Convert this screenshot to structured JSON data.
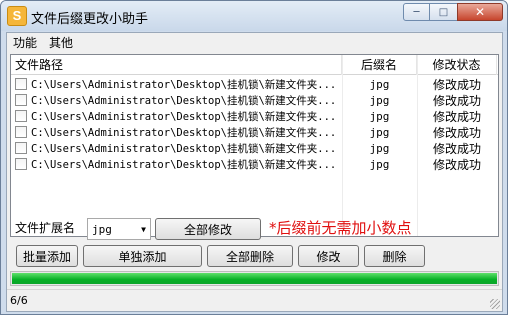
{
  "window": {
    "title": "文件后缀更改小助手",
    "icon_letter": "S",
    "buttons": {
      "minimize": "─",
      "maximize": "□",
      "close": "✕"
    }
  },
  "menu": [
    "功能",
    "其他"
  ],
  "table": {
    "headers": [
      "文件路径",
      "后缀名",
      "修改状态"
    ],
    "rows": [
      {
        "path": "C:\\Users\\Administrator\\Desktop\\挂机锁\\新建文件夹...",
        "ext": "jpg",
        "status": "修改成功",
        "checked": false
      },
      {
        "path": "C:\\Users\\Administrator\\Desktop\\挂机锁\\新建文件夹...",
        "ext": "jpg",
        "status": "修改成功",
        "checked": false
      },
      {
        "path": "C:\\Users\\Administrator\\Desktop\\挂机锁\\新建文件夹...",
        "ext": "jpg",
        "status": "修改成功",
        "checked": false
      },
      {
        "path": "C:\\Users\\Administrator\\Desktop\\挂机锁\\新建文件夹...",
        "ext": "jpg",
        "status": "修改成功",
        "checked": false
      },
      {
        "path": "C:\\Users\\Administrator\\Desktop\\挂机锁\\新建文件夹...",
        "ext": "jpg",
        "status": "修改成功",
        "checked": false
      },
      {
        "path": "C:\\Users\\Administrator\\Desktop\\挂机锁\\新建文件夹...",
        "ext": "jpg",
        "status": "修改成功",
        "checked": false
      }
    ]
  },
  "controls": {
    "ext_label": "文件扩展名",
    "ext_value": "jpg",
    "modify_all": "全部修改",
    "hint": "*后缀前无需加小数点",
    "batch_add": "批量添加",
    "single_add": "单独添加",
    "delete_all": "全部删除",
    "modify": "修改",
    "delete": "删除"
  },
  "progress": {
    "value": 1.0,
    "color": "#06b025"
  },
  "status": {
    "text": "6/6"
  }
}
